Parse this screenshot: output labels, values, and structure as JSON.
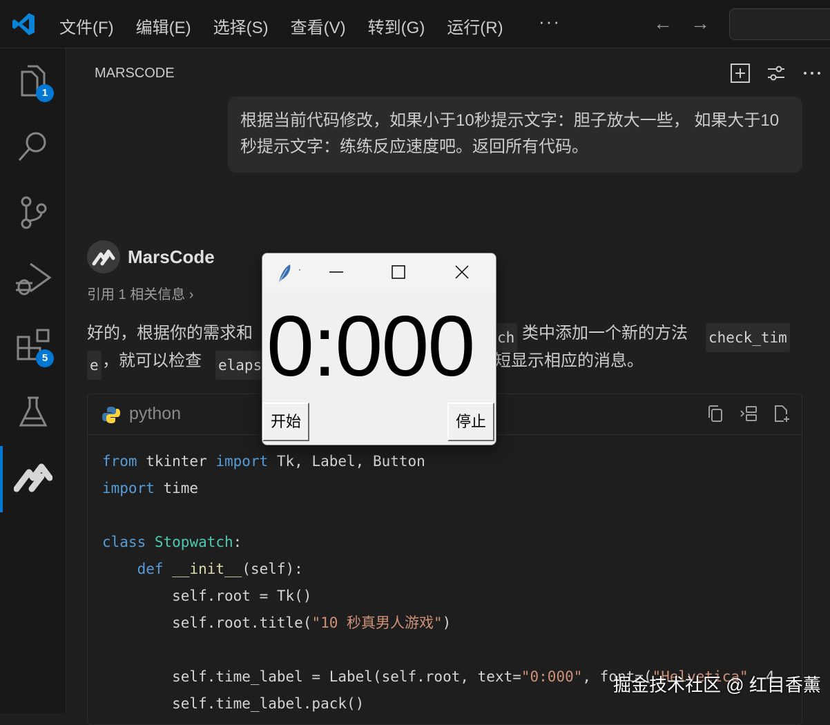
{
  "titlebar": {
    "menu": [
      "文件(F)",
      "编辑(E)",
      "选择(S)",
      "查看(V)",
      "转到(G)",
      "运行(R)"
    ],
    "more": "···",
    "back": "←",
    "forward": "→"
  },
  "activitybar": {
    "explorer_badge": "1",
    "extensions_badge": "5",
    "accent_color": "#0078d4"
  },
  "panel": {
    "title": "MARSCODE",
    "user_message": "根据当前代码修改，如果小于10秒提示文字：胆子放大一些， 如果大于10秒提示文字：练练反应速度吧。返回所有代码。",
    "assistant_name": "MarsCode",
    "reference": "引用 1 相关信息 ›",
    "answer": {
      "l1_a": "好的，根据你的需求和",
      "l1_code": "ch",
      "l1_b": "类中添加一个新的方法",
      "l1_code2": "check_tim",
      "l2_code": "e",
      "l2_a": "，就可以检查",
      "l2_code2": "elaps",
      "l2_b": "短显示相应的消息。"
    },
    "code": {
      "language": "python",
      "lines": [
        "from tkinter import Tk, Label, Button",
        "import time",
        "",
        "class Stopwatch:",
        "    def __init__(self):",
        "        self.root = Tk()",
        "        self.root.title(\"10 秒真男人游戏\")",
        "",
        "        self.time_label = Label(self.root, text=\"0:000\", font=(\"Helvetica\", 4",
        "        self.time_label.pack()"
      ]
    }
  },
  "tk_window": {
    "title": "·",
    "time": "0:000",
    "start": "开始",
    "stop": "停止"
  },
  "watermark": "掘金技术社区 @ 红目香薰"
}
